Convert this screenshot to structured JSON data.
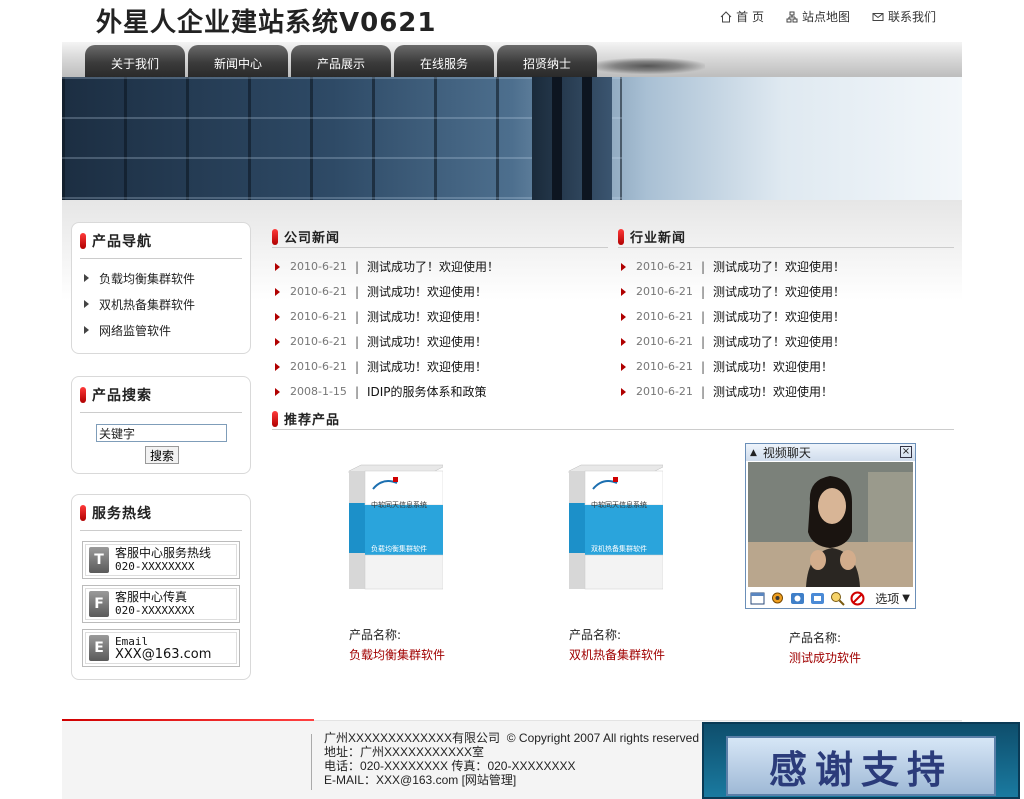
{
  "header": {
    "title": "外星人企业建站系统V0621",
    "links": [
      {
        "label": "首 页",
        "icon": "home-icon"
      },
      {
        "label": "站点地图",
        "icon": "sitemap-icon"
      },
      {
        "label": "联系我们",
        "icon": "mail-icon"
      }
    ]
  },
  "nav": {
    "tabs": [
      {
        "label": "关于我们"
      },
      {
        "label": "新闻中心"
      },
      {
        "label": "产品展示"
      },
      {
        "label": "在线服务"
      },
      {
        "label": "招贤纳士"
      }
    ]
  },
  "sidebar": {
    "product_nav": {
      "title": "产品导航",
      "items": [
        {
          "label": "负载均衡集群软件"
        },
        {
          "label": "双机热备集群软件"
        },
        {
          "label": "网络监管软件"
        }
      ]
    },
    "product_search": {
      "title": "产品搜索",
      "input_value": "关键字",
      "button_label": "搜索"
    },
    "hotline": {
      "title": "服务热线",
      "items": [
        {
          "icon_letter": "T",
          "line1": "客服中心服务热线",
          "line2": "020-XXXXXXXX"
        },
        {
          "icon_letter": "F",
          "line1": "客服中心传真",
          "line2": "020-XXXXXXXX"
        },
        {
          "icon_letter": "E",
          "line1": "Email",
          "line2": "XXX@163.com"
        }
      ]
    }
  },
  "company_news": {
    "title": "公司新闻",
    "items": [
      {
        "date": "2010-6-21",
        "title": "测试成功了！欢迎使用！"
      },
      {
        "date": "2010-6-21",
        "title": "测试成功！欢迎使用！"
      },
      {
        "date": "2010-6-21",
        "title": "测试成功！欢迎使用！"
      },
      {
        "date": "2010-6-21",
        "title": "测试成功！欢迎使用！"
      },
      {
        "date": "2010-6-21",
        "title": "测试成功！欢迎使用！"
      },
      {
        "date": "2008-1-15",
        "title": "IDIP的服务体系和政策"
      }
    ]
  },
  "industry_news": {
    "title": "行业新闻",
    "items": [
      {
        "date": "2010-6-21",
        "title": "测试成功了！欢迎使用！"
      },
      {
        "date": "2010-6-21",
        "title": "测试成功了！欢迎使用！"
      },
      {
        "date": "2010-6-21",
        "title": "测试成功了！欢迎使用！"
      },
      {
        "date": "2010-6-21",
        "title": "测试成功了！欢迎使用！"
      },
      {
        "date": "2010-6-21",
        "title": "测试成功！欢迎使用！"
      },
      {
        "date": "2010-6-21",
        "title": "测试成功！欢迎使用！"
      }
    ]
  },
  "recommended": {
    "title": "推荐产品",
    "name_label": "产品名称:",
    "box_top_text": "中软同天信息系统",
    "products": [
      {
        "name": "负载均衡集群软件",
        "box_text": "负载均衡集群软件"
      },
      {
        "name": "双机热备集群软件",
        "box_text": "双机热备集群软件"
      },
      {
        "name": "测试成功软件"
      }
    ]
  },
  "video_chat": {
    "title": "视频聊天",
    "options_label": "选项"
  },
  "footer": {
    "company": "广州XXXXXXXXXXXXX有限公司",
    "copyright": "© Copyright 2007 All rights reserved",
    "address_label": "地址：",
    "address": "广州XXXXXXXXXXX室",
    "phone_label": "电话：",
    "phone": "020-XXXXXXXX",
    "fax_label": "传真：",
    "fax": "020-XXXXXXXX",
    "email_label": "E-MAIL：",
    "email": "XXX@163.com",
    "admin_link": "网站管理",
    "thanks": "感谢支持"
  },
  "colors": {
    "accent_red": "#b00000",
    "product_name_red": "#a00000",
    "nav_tab": "#3b3b3b"
  }
}
